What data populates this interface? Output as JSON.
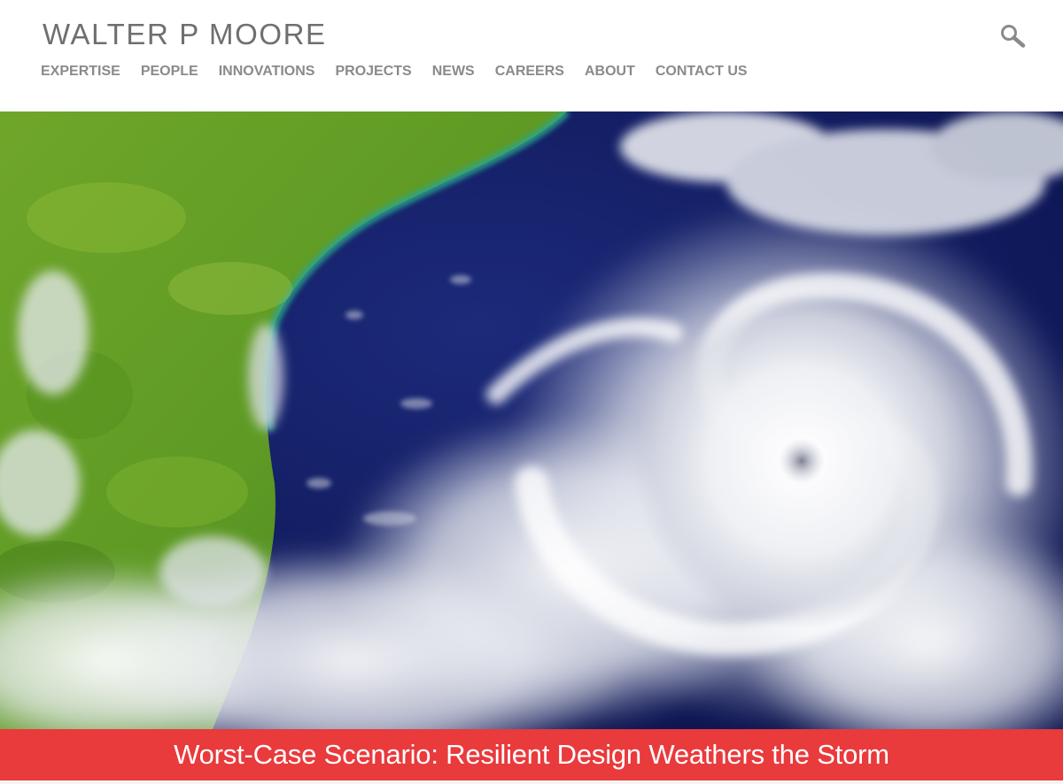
{
  "header": {
    "logo_text": "WALTER P MOORE",
    "search_icon": "search-icon",
    "nav": [
      {
        "label": "EXPERTISE"
      },
      {
        "label": "PEOPLE"
      },
      {
        "label": "INNOVATIONS"
      },
      {
        "label": "PROJECTS"
      },
      {
        "label": "NEWS"
      },
      {
        "label": "CAREERS"
      },
      {
        "label": "ABOUT"
      },
      {
        "label": "CONTACT US"
      }
    ]
  },
  "hero": {
    "image_subject": "satellite image of a hurricane near a coastline",
    "banner_title": "Worst-Case Scenario: Resilient Design Weathers the Storm"
  },
  "colors": {
    "banner_bg": "#e93a3c",
    "nav_text": "#8a8a8a",
    "logo_text": "#6f6f6f"
  }
}
